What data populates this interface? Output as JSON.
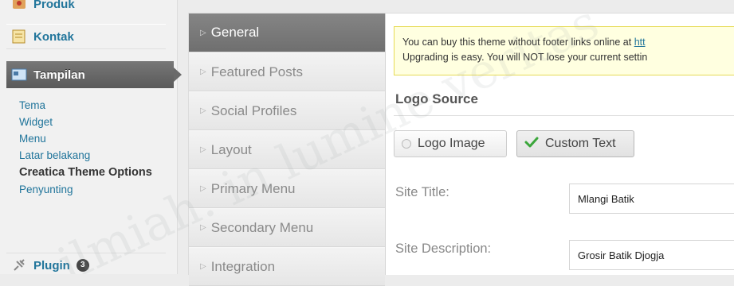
{
  "menu": {
    "produk_label": "Produk",
    "kontak_label": "Kontak",
    "tampilan_label": "Tampilan",
    "submenu": [
      {
        "label": "Tema"
      },
      {
        "label": "Widget"
      },
      {
        "label": "Menu"
      },
      {
        "label": "Latar belakang"
      },
      {
        "label": "Creatica Theme Options"
      },
      {
        "label": "Penyunting"
      }
    ],
    "plugin_label": "Plugin",
    "plugin_badge": "3"
  },
  "tabs": [
    {
      "label": "General",
      "active": true
    },
    {
      "label": "Featured Posts"
    },
    {
      "label": "Social Profiles"
    },
    {
      "label": "Layout"
    },
    {
      "label": "Primary Menu"
    },
    {
      "label": "Secondary Menu"
    },
    {
      "label": "Integration"
    }
  ],
  "notice": {
    "line1": "You can buy this theme without footer links online at ",
    "link": "htt",
    "line2": "Upgrading is easy. You will NOT lose your current settin"
  },
  "logo": {
    "heading": "Logo Source",
    "option_image": "Logo Image",
    "option_text": "Custom Text",
    "selected": "Custom Text"
  },
  "fields": {
    "site_title_label": "Site Title:",
    "site_title_value": "Mlangi Batik",
    "site_desc_label": "Site Description:",
    "site_desc_value": "Grosir Batik Djogja"
  },
  "watermark": "ilmiah. in lumine veritas",
  "colors": {
    "link": "#21759b",
    "active_tab": "#7a7a7a",
    "notice_bg": "#ffffe0",
    "check_green": "#3aa63a"
  }
}
